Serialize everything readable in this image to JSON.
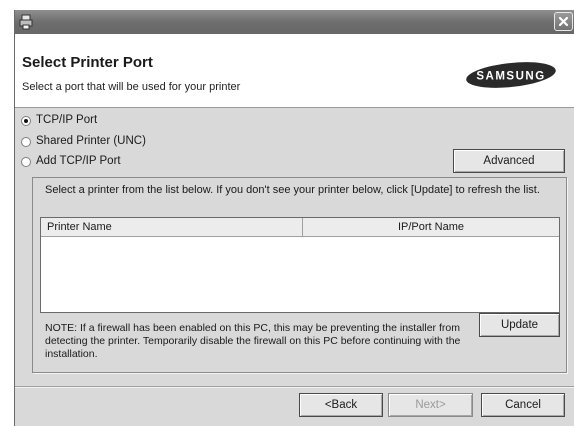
{
  "window": {
    "title_icon": "installer-icon",
    "close_icon": "close-icon"
  },
  "header": {
    "title": "Select Printer Port",
    "subtitle": "Select a port that will be used for your printer",
    "logo_text": "SAMSUNG"
  },
  "port_options": [
    {
      "label": "TCP/IP Port",
      "checked": true
    },
    {
      "label": "Shared Printer (UNC)",
      "checked": false
    },
    {
      "label": "Add TCP/IP Port",
      "checked": false
    }
  ],
  "advanced_label": "Advanced",
  "instruction": "Select a printer from the list below. If you don't see your printer below, click [Update] to refresh the list.",
  "printer_list": {
    "columns": [
      "Printer Name",
      "IP/Port Name"
    ],
    "rows": []
  },
  "note": "NOTE: If a firewall has been enabled on this PC, this may be preventing the installer from detecting the printer. Temporarily disable the firewall on this PC before continuing with the installation.",
  "update_label": "Update",
  "footer": {
    "back_label": "<Back",
    "next_label": "Next>",
    "cancel_label": "Cancel"
  },
  "colors": {
    "dialog_bg": "#d9d9d9",
    "titlebar": "#6e6e6e",
    "header_bg": "#ffffff"
  }
}
